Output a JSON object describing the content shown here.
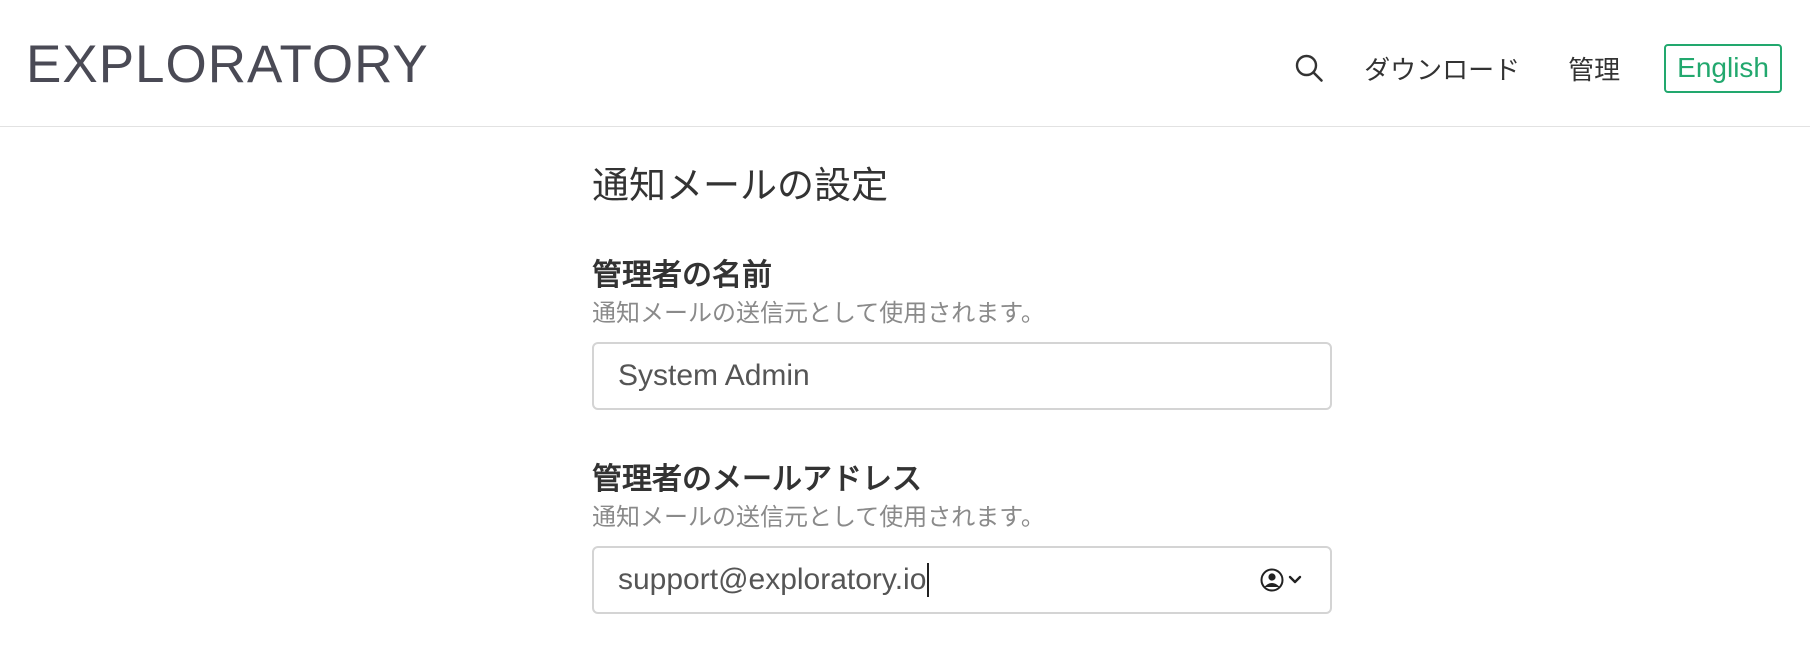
{
  "header": {
    "logo": "EXPLORATORY",
    "nav": {
      "search_icon": "search-icon",
      "download": "ダウンロード",
      "admin": "管理",
      "language": "English"
    },
    "colors": {
      "accent": "#22a86e",
      "border": "#e2e2e2"
    }
  },
  "main": {
    "title": "通知メールの設定",
    "admin_name": {
      "label": "管理者の名前",
      "help": "通知メールの送信元として使用されます。",
      "value": "System Admin"
    },
    "admin_email": {
      "label": "管理者のメールアドレス",
      "help": "通知メールの送信元として使用されます。",
      "value": "support@exploratory.io",
      "autofill_icon": "account-autofill-icon"
    }
  }
}
